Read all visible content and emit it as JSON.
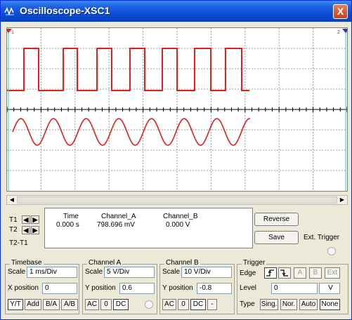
{
  "window": {
    "title": "Oscilloscope-XSC1",
    "close_label": "X"
  },
  "colors": {
    "channel_a": "#e0201b",
    "channel_b": "#e0201b",
    "cursor_1": "#e0201b",
    "cursor_2": "#3030c0",
    "background": "#ffffff"
  },
  "cursors": {
    "t1_label": "T1",
    "t2_label": "T2",
    "t2t1_label": "T2-T1"
  },
  "readout": {
    "time_header": "Time",
    "channel_a_header": "Channel_A",
    "channel_b_header": "Channel_B",
    "time_value": "0.000 s",
    "channel_a_value": "798.696 mV",
    "channel_b_value": "0.000 V"
  },
  "buttons": {
    "reverse": "Reverse",
    "save": "Save",
    "ext_trigger": "Ext. Trigger"
  },
  "timebase": {
    "title": "Timebase",
    "scale_label": "Scale",
    "scale_value": "1 ms/Div",
    "xpos_label": "X position",
    "xpos_value": "0",
    "modes": [
      "Y/T",
      "Add",
      "B/A",
      "A/B"
    ]
  },
  "channel_a": {
    "title": "Channel A",
    "scale_label": "Scale",
    "scale_value": "5  V/Div",
    "ypos_label": "Y position",
    "ypos_value": "0.6",
    "coupling": [
      "AC",
      "0",
      "DC"
    ]
  },
  "channel_b": {
    "title": "Channel B",
    "scale_label": "Scale",
    "scale_value": "10  V/Div",
    "ypos_label": "Y position",
    "ypos_value": "-0.8",
    "coupling": [
      "AC",
      "0",
      "DC",
      "-"
    ]
  },
  "trigger": {
    "title": "Trigger",
    "edge_label": "Edge",
    "edge_buttons": [
      "A",
      "B",
      "Ext"
    ],
    "level_label": "Level",
    "level_value": "0",
    "level_unit": "V",
    "type_label": "Type",
    "types": [
      "Sing.",
      "Nor.",
      "Auto",
      "None"
    ]
  }
}
